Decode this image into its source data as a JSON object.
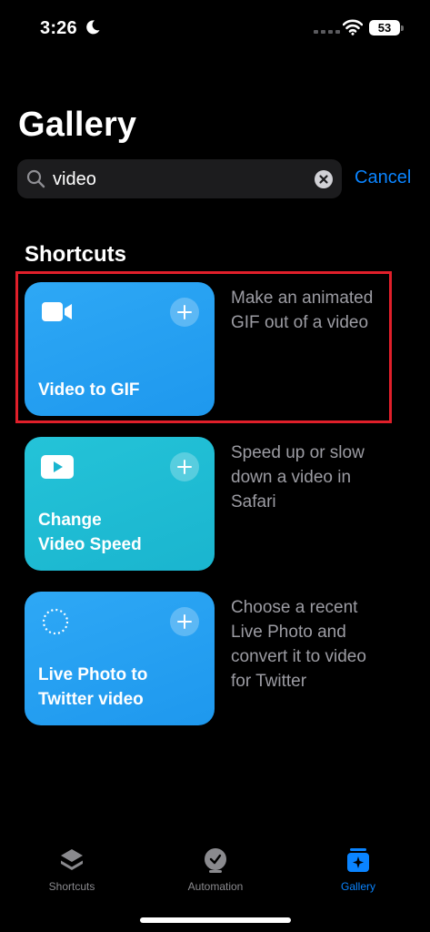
{
  "status_bar": {
    "time": "3:26",
    "battery": "53"
  },
  "header": {
    "title": "Gallery"
  },
  "search": {
    "value": "video",
    "cancel_label": "Cancel"
  },
  "section": {
    "title": "Shortcuts"
  },
  "shortcuts": [
    {
      "label": "Video to GIF",
      "description": "Make an animated\nGIF out of a video",
      "icon": "video-camera-icon",
      "color": "#1e98ee"
    },
    {
      "label": "Change\nVideo Speed",
      "description": "Speed up or slow\ndown a video in\nSafari",
      "icon": "play-icon",
      "color": "#1ab5cf"
    },
    {
      "label": "Live Photo to\nTwitter video",
      "description": "Choose a recent\nLive Photo and\nconvert it to video\nfor Twitter",
      "icon": "live-photo-icon",
      "color": "#1e98ee"
    }
  ],
  "tab_bar": {
    "tabs": [
      {
        "label": "Shortcuts",
        "icon": "layers-icon"
      },
      {
        "label": "Automation",
        "icon": "clock-icon"
      },
      {
        "label": "Gallery",
        "icon": "gallery-icon",
        "active": true
      }
    ]
  },
  "colors": {
    "accent": "#0a84ff",
    "highlight": "#e01f2a",
    "card_blue": "#1e98ee",
    "card_teal": "#1ab5cf"
  }
}
